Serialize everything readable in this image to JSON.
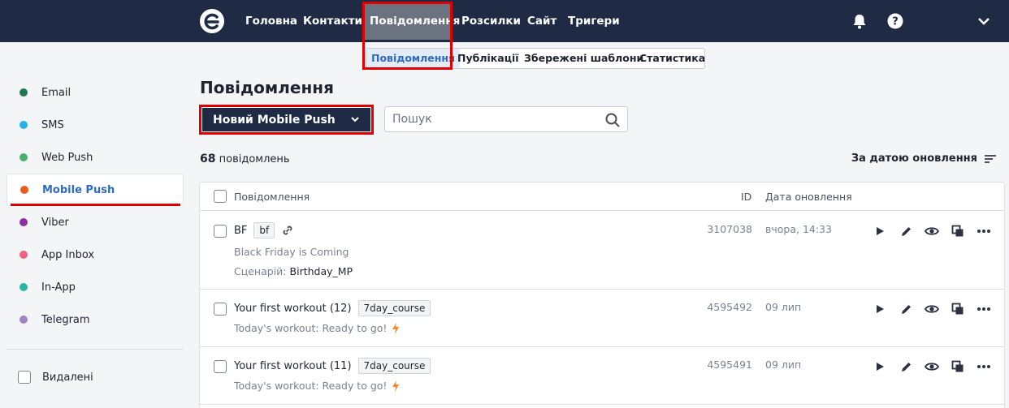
{
  "topnav": {
    "items": [
      {
        "label": "Головна"
      },
      {
        "label": "Контакти"
      },
      {
        "label": "Повідомлення",
        "active": true
      },
      {
        "label": "Розсилки"
      },
      {
        "label": "Сайт"
      },
      {
        "label": "Тригери"
      }
    ]
  },
  "subnav": {
    "items": [
      {
        "label": "Повідомлення",
        "active": true
      },
      {
        "label": "Публікації"
      },
      {
        "label": "Збережені шаблони"
      },
      {
        "label": "Статистика"
      }
    ]
  },
  "sidebar": {
    "items": [
      {
        "label": "Email",
        "color": "#1e7a4e"
      },
      {
        "label": "SMS",
        "color": "#27b3e6"
      },
      {
        "label": "Web Push",
        "color": "#4caf6e"
      },
      {
        "label": "Mobile Push",
        "color": "#ef5a1c",
        "active": true
      },
      {
        "label": "Viber",
        "color": "#8e2fa6"
      },
      {
        "label": "App Inbox",
        "color": "#f0607f"
      },
      {
        "label": "In-App",
        "color": "#26b7a4"
      },
      {
        "label": "Telegram",
        "color": "#a083c4"
      }
    ],
    "deleted_label": "Видалені"
  },
  "main": {
    "title": "Повідомлення",
    "new_button_label": "Новий Mobile Push",
    "search_placeholder": "Пошук",
    "count_number": "68",
    "count_label": "повідомлень",
    "sort_label": "За датою оновлення"
  },
  "table": {
    "headers": {
      "message": "Повідомлення",
      "id": "ID",
      "date": "Дата оновлення"
    },
    "rows": [
      {
        "title": "BF",
        "tag": "bf",
        "subtitle": "Black Friday is Coming",
        "scenario_label": "Сценарій:",
        "scenario": "Birthday_MP",
        "id": "3107038",
        "date": "вчора, 14:33"
      },
      {
        "title": "Your first workout (12)",
        "tag": "7day_course",
        "subtitle": "Today's workout: Ready to go!",
        "id": "4595492",
        "date": "09 лип"
      },
      {
        "title": "Your first workout (11)",
        "tag": "7day_course",
        "subtitle": "Today's workout: Ready to go!",
        "id": "4595491",
        "date": "09 лип"
      }
    ]
  },
  "colors": {
    "topbar": "#1f2a44",
    "highlight": "#e00000",
    "accent": "#2e6bbf"
  },
  "icons": [
    "logo-icon",
    "bell-icon",
    "help-icon",
    "chevron-down-icon",
    "search-icon",
    "sort-icon",
    "link-icon",
    "lightning-icon",
    "play-icon",
    "pencil-icon",
    "eye-icon",
    "copy-icon",
    "more-icon"
  ]
}
